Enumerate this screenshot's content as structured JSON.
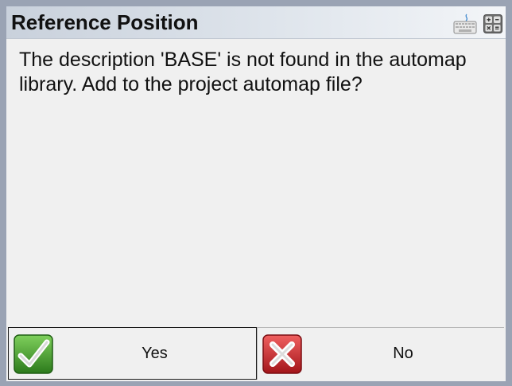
{
  "dialog": {
    "title": "Reference Position",
    "message": "The description 'BASE' is not found in the automap library. Add to the project automap file?",
    "icons": {
      "keyboard": "keyboard-icon",
      "calculator": "calculator-icon"
    }
  },
  "buttons": {
    "yes": {
      "label": "Yes",
      "icon": "checkmark-icon",
      "color": "#3f9a2d"
    },
    "no": {
      "label": "No",
      "icon": "x-mark-icon",
      "color": "#c8242a"
    }
  }
}
